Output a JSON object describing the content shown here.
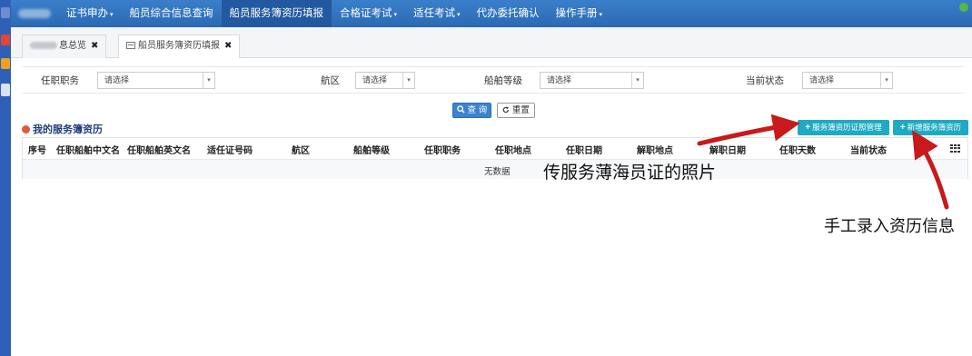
{
  "topnav": {
    "items": [
      {
        "label": "证书申办",
        "dropdown": true,
        "active": false
      },
      {
        "label": "船员综合信息查询",
        "dropdown": false,
        "active": false
      },
      {
        "label": "船员服务簿资历填报",
        "dropdown": false,
        "active": true
      },
      {
        "label": "合格证考试",
        "dropdown": true,
        "active": false
      },
      {
        "label": "适任考试",
        "dropdown": true,
        "active": false
      },
      {
        "label": "代办委托确认",
        "dropdown": false,
        "active": false
      },
      {
        "label": "操作手册",
        "dropdown": true,
        "active": false
      }
    ],
    "caret": "▾"
  },
  "tabs": {
    "home_label": "息总览",
    "current_label": "船员服务簿资历填报",
    "close_glyph": "✖"
  },
  "filters": {
    "position_label": "任职职务",
    "position_value": "请选择",
    "area_label": "航区",
    "area_value": "请选择",
    "grade_label": "船舶等级",
    "grade_value": "请选择",
    "status_label": "当前状态",
    "status_value": "请选择",
    "arrow": "▾"
  },
  "actions": {
    "query_label": "查 询",
    "reset_label": "重置",
    "cert_manage_label": "服务簿资历证照管理",
    "add_record_label": "新增服务簿资历"
  },
  "section": {
    "title": "我的服务簿资历"
  },
  "table": {
    "columns": [
      "序号",
      "任职船舶中文名",
      "任职船舶英文名",
      "适任证号码",
      "航区",
      "船舶等级",
      "任职职务",
      "任职地点",
      "任职日期",
      "解职地点",
      "解职日期",
      "任职天数",
      "当前状态"
    ],
    "empty_text": "无数据"
  },
  "annotations": {
    "upload_photo": "传服务薄海员证的照片",
    "manual_entry": "手工录入资历信息"
  },
  "colors": {
    "nav_bg": "#2c69b3",
    "primary_button": "#3b82cf",
    "teal_button": "#1eaac2",
    "arrow_red": "#c8191b"
  }
}
